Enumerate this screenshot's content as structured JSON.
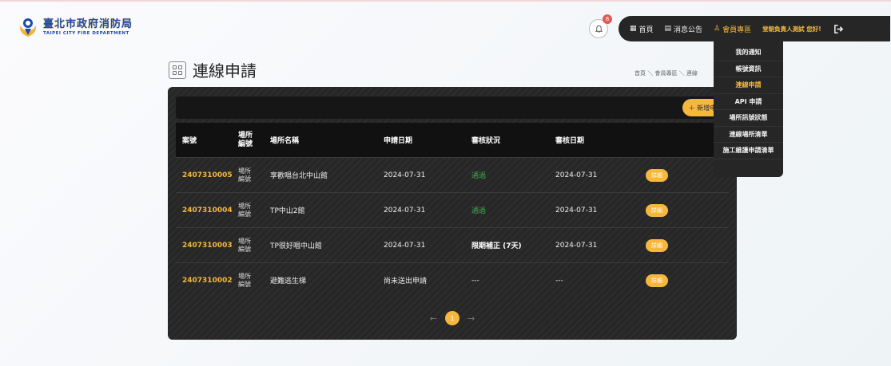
{
  "logo": {
    "zh": "臺北市政府消防局",
    "en": "TAIPEI CITY FIRE DEPARTMENT"
  },
  "notifications": {
    "count": "8"
  },
  "nav": {
    "home": "首頁",
    "news": "消息公告",
    "member": "會員專區",
    "greeting": "堂朝負責人測試 您好!"
  },
  "dropdown": [
    "我的通知",
    "帳號資訊",
    "連線申請",
    "API 申請",
    "場所訊號狀態",
    "連線場所清單",
    "施工維護申請清單"
  ],
  "dropdown_active": "連線申請",
  "page": {
    "title": "連線申請",
    "breadcrumb": "首頁 ＼ 會員專區 ＼ 連線"
  },
  "toolbar": {
    "add_label": "＋ 新增申請"
  },
  "table": {
    "headers": {
      "case": "案號",
      "venue_no": "場所\n編號",
      "venue_name": "場所名稱",
      "apply_date": "申請日期",
      "status": "審核狀況",
      "review_date": "審核日期"
    },
    "rows": [
      {
        "case": "2407310005",
        "venue_no": "場所\n編號",
        "venue_name": "享歡唱台北中山館",
        "apply_date": "2024-07-31",
        "status": "通過",
        "review_date": "2024-07-31",
        "detail": "詳細"
      },
      {
        "case": "2407310004",
        "venue_no": "場所\n編號",
        "venue_name": "TP中山2館",
        "apply_date": "2024-07-31",
        "status": "通過",
        "review_date": "2024-07-31",
        "detail": "詳細"
      },
      {
        "case": "2407310003",
        "venue_no": "場所\n編號",
        "venue_name": "TP很好唱中山館",
        "apply_date": "2024-07-31",
        "status": "限期補正 (7天)",
        "review_date": "2024-07-31",
        "detail": "詳細"
      },
      {
        "case": "2407310002",
        "venue_no": "場所\n編號",
        "venue_name": "避難逃生梯",
        "apply_date": "尚未送出申請",
        "status": "---",
        "review_date": "---",
        "detail": "詳細"
      }
    ]
  },
  "pager": {
    "prev": "←",
    "current": "1",
    "next": "→"
  },
  "colors": {
    "accent": "#f6b73c",
    "dark": "#262626",
    "approved": "#3ba84a"
  }
}
